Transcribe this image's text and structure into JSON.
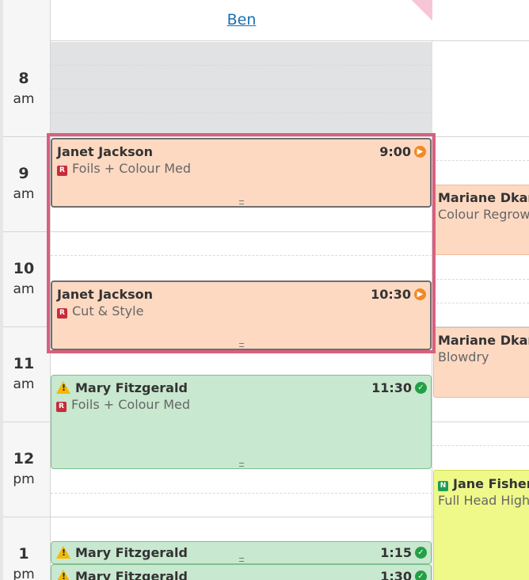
{
  "staff": {
    "name": "Ben"
  },
  "hours": [
    {
      "hour": "8",
      "ampm": "am"
    },
    {
      "hour": "9",
      "ampm": "am"
    },
    {
      "hour": "10",
      "ampm": "am"
    },
    {
      "hour": "11",
      "ampm": "am"
    },
    {
      "hour": "12",
      "ampm": "pm"
    },
    {
      "hour": "1",
      "ampm": "pm"
    }
  ],
  "appointments": [
    {
      "client": "Janet Jackson",
      "service": "Foils + Colour Med",
      "time": "9:00",
      "tag": "R",
      "status": "play"
    },
    {
      "client": "Janet Jackson",
      "service": "Cut & Style",
      "time": "10:30",
      "tag": "R",
      "status": "play"
    },
    {
      "client": "Mary Fitzgerald",
      "service": "Foils + Colour Med",
      "time": "11:30",
      "tag": "R",
      "status": "check",
      "warning": true
    },
    {
      "client": "Mary Fitzgerald",
      "service": "",
      "time": "1:15",
      "status": "check",
      "warning": true
    },
    {
      "client": "Mary Fitzgerald",
      "service": "",
      "time": "1:30",
      "status": "check",
      "warning": true
    }
  ],
  "other_column": [
    {
      "client": "Mariane Dkari",
      "service": "Colour Regrowth"
    },
    {
      "client": "Mariane Dkari",
      "service": "Blowdry"
    },
    {
      "client": "Jane Fisher",
      "service": "Full Head Highlights",
      "tag": "N"
    }
  ],
  "colors": {
    "selection": "#d8607e",
    "staff_link": "#1a6fb0",
    "orange_appt": "#fdd9c2",
    "green_appt": "#c8e8cf",
    "lime_appt": "#eef98a"
  },
  "icons": {
    "status_play": "play-circle-icon",
    "status_check": "check-circle-icon",
    "warning": "warning-triangle-icon"
  }
}
